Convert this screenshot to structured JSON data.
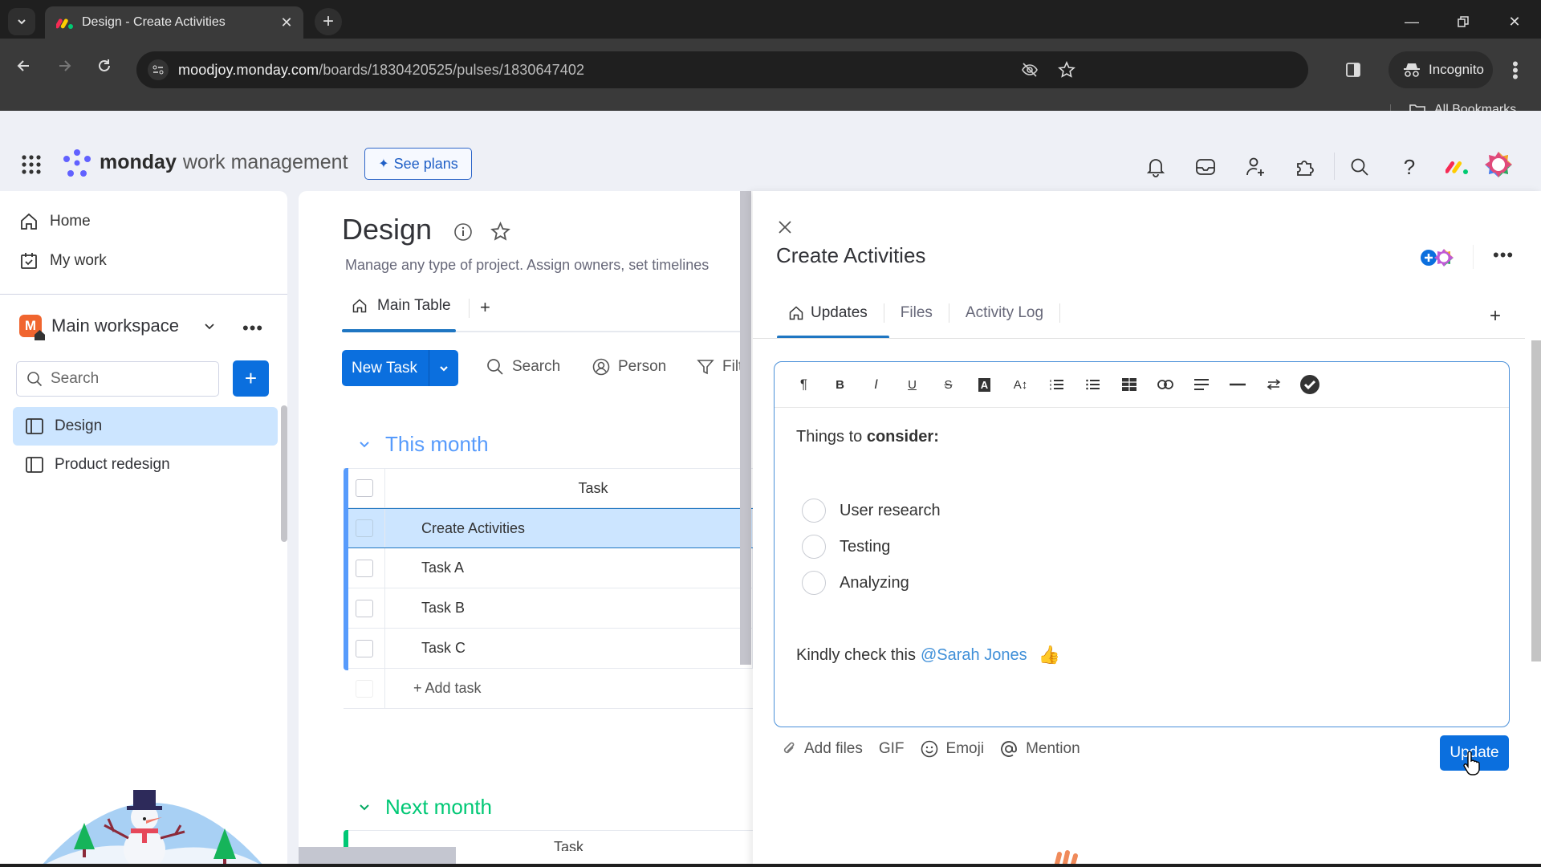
{
  "browser": {
    "tab_title": "Design - Create Activities",
    "url_host": "moodjoy.monday.com",
    "url_path": "/boards/1830420525/pulses/1830647402",
    "incognito_label": "Incognito",
    "bookmarks_label": "All Bookmarks"
  },
  "app": {
    "brand": "monday",
    "brand_sub": "work management",
    "see_plans_label": "See plans",
    "top_icons": [
      "notifications-icon",
      "inbox-icon",
      "invite-members-icon",
      "apps-icon",
      "search-icon",
      "help-icon"
    ]
  },
  "sidebar": {
    "home_label": "Home",
    "mywork_label": "My work",
    "workspace_name": "Main workspace",
    "workspace_initial": "M",
    "search_placeholder": "Search",
    "boards": [
      {
        "label": "Design",
        "active": true
      },
      {
        "label": "Product redesign",
        "active": false
      }
    ]
  },
  "board": {
    "title": "Design",
    "description": "Manage any type of project. Assign owners, set timelines",
    "view_tab": "Main Table",
    "new_task_label": "New Task",
    "search_label": "Search",
    "person_label": "Person",
    "filter_label": "Filter",
    "groups": [
      {
        "name": "This month",
        "color": "#579bfc",
        "column_header": "Task",
        "rows": [
          "Create Activities",
          "Task A",
          "Task B",
          "Task C"
        ],
        "selected_row": "Create Activities",
        "add_label": "+ Add task"
      },
      {
        "name": "Next month",
        "color": "#00c875",
        "column_header": "Task"
      }
    ]
  },
  "item_panel": {
    "title": "Create Activities",
    "tabs": [
      {
        "label": "Updates",
        "active": true
      },
      {
        "label": "Files",
        "active": false
      },
      {
        "label": "Activity Log",
        "active": false
      }
    ],
    "editor_toolbar": [
      "paragraph",
      "bold",
      "italic",
      "underline",
      "strikethrough",
      "text-color",
      "font-size",
      "numbered-list",
      "bulleted-list",
      "table",
      "link",
      "align",
      "divider",
      "direction",
      "checklist"
    ],
    "content": {
      "intro_plain": "Things to ",
      "intro_bold": "consider:",
      "checklist": [
        {
          "label": "User research",
          "checked": false
        },
        {
          "label": "Testing",
          "checked": false
        },
        {
          "label": "Analyzing",
          "checked": false
        }
      ],
      "mention_prefix": "Kindly check this",
      "mention_name": "@Sarah Jones",
      "mention_emoji": "👍"
    },
    "composer": {
      "add_files_label": "Add files",
      "gif_label": "GIF",
      "emoji_label": "Emoji",
      "mention_label": "Mention",
      "update_label": "Update"
    }
  }
}
